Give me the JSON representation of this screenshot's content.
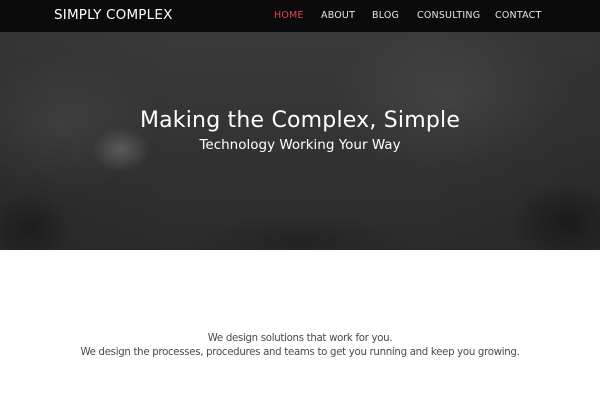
{
  "brand": "SIMPLY COMPLEX",
  "nav": [
    {
      "label": "HOME",
      "active": true
    },
    {
      "label": "ABOUT",
      "active": false
    },
    {
      "label": "BLOG",
      "active": false
    },
    {
      "label": "CONSULTING",
      "active": false
    },
    {
      "label": "CONTACT",
      "active": false
    }
  ],
  "hero": {
    "title": "Making the Complex, Simple",
    "subtitle": "Technology Working Your Way"
  },
  "content": {
    "line1": "We design solutions that work for you.",
    "line2": "We design the processes, procedures and teams to get you running and keep you growing."
  },
  "colors": {
    "navbar_bg": "#0b0b0b",
    "nav_active": "#e0464f",
    "nav_text": "#e6e6e6",
    "hero_bg": "#363636",
    "body_text": "#4a4a4a"
  }
}
